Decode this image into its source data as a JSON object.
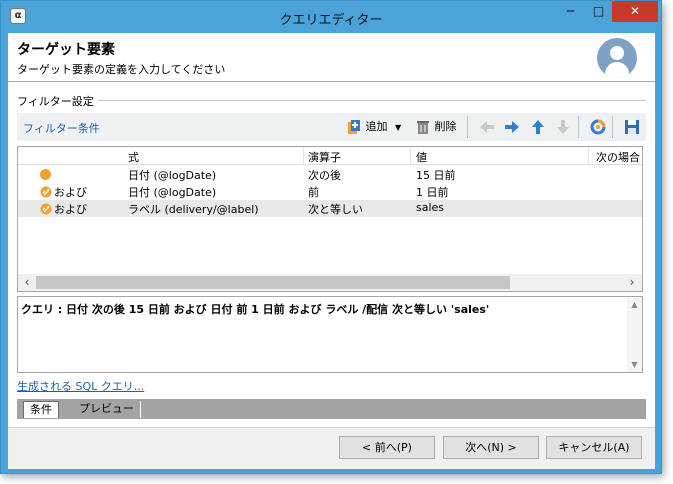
{
  "window": {
    "title": "クエリエディター",
    "minimize": "─",
    "maximize": "□",
    "close": "✕"
  },
  "header": {
    "title": "ターゲット要素",
    "subtitle": "ターゲット要素の定義を入力してください"
  },
  "section": {
    "label": "フィルター設定"
  },
  "toolbar": {
    "condition_link": "フィルター条件",
    "add_label": "追加",
    "delete_label": "削除",
    "icons": [
      "add-icon",
      "trash-icon",
      "arrow-left-icon",
      "arrow-right-icon",
      "arrow-up-icon",
      "arrow-down-icon",
      "refresh-icon",
      "save-icon"
    ]
  },
  "grid": {
    "columns": [
      "式",
      "演算子",
      "値",
      "次の場合"
    ],
    "rows": [
      {
        "logic": "",
        "expression": "日付 (@logDate)",
        "operator": "次の後",
        "value": "15 日前"
      },
      {
        "logic": "および",
        "expression": "日付 (@logDate)",
        "operator": "前",
        "value": "1 日前"
      },
      {
        "logic": "および",
        "expression": "ラベル (delivery/@label)",
        "operator": "次と等しい",
        "value": "sales"
      }
    ]
  },
  "query": {
    "text": "クエリ : 日付 次の後 15 日前 および 日付 前 1 日前 および ラベル /配信 次と等しい 'sales'"
  },
  "sql_link": "生成される SQL クエリ...",
  "tabs": [
    "条件",
    "プレビュー"
  ],
  "footer": {
    "prev": "< 前へ(P)",
    "next": "次へ(N) >",
    "cancel": "キャンセル(A)"
  },
  "colors": {
    "title_bar": "#4aa3d9",
    "close_button": "#c7392b",
    "link": "#1f5fa8",
    "avatar": "#7fa1c6",
    "condition_dot": "#f0a030"
  }
}
